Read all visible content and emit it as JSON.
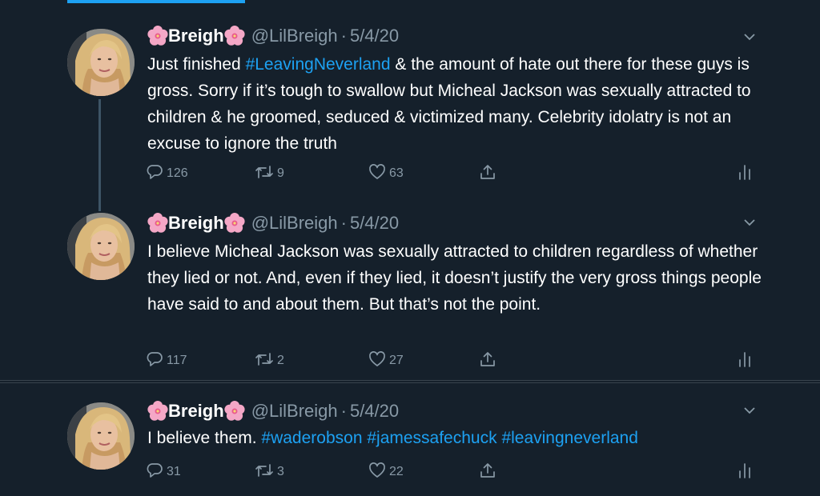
{
  "colors": {
    "background": "#15202b",
    "accent": "#1da1f2",
    "secondary_text": "#8899a6",
    "divider": "#38444d"
  },
  "tweets": [
    {
      "display_name": "Breigh",
      "handle": "@LilBreigh",
      "separator": "·",
      "date": "5/4/20",
      "text_parts": {
        "a": "Just finished ",
        "hashtag": "#LeavingNeverland",
        "b": " & the amount of hate out there for these guys is gross.  Sorry if it’s tough to swallow but Micheal Jackson was sexually attracted to children & he groomed, seduced & victimized many.  Celebrity idolatry is not an excuse to ignore the truth"
      },
      "replies": "126",
      "retweets": "9",
      "likes": "63"
    },
    {
      "display_name": "Breigh",
      "handle": "@LilBreigh",
      "separator": "·",
      "date": "5/4/20",
      "text": "I believe Micheal Jackson was sexually attracted to children regardless of whether they lied or not.  And, even if they lied, it doesn’t justify the very gross things people have said to and about them.  But that’s not the point.",
      "replies": "117",
      "retweets": "2",
      "likes": "27"
    },
    {
      "display_name": "Breigh",
      "handle": "@LilBreigh",
      "separator": "·",
      "date": "5/4/20",
      "text_parts": {
        "a": "I believe them.  ",
        "h1": "#waderobson",
        "h2": "#jamessafechuck",
        "h3": "#leavingneverland"
      },
      "replies": "31",
      "retweets": "3",
      "likes": "22"
    }
  ],
  "icons": {
    "flower": "cherry-blossom-emoji",
    "caret": "chevron-down-icon",
    "reply": "reply-icon",
    "retweet": "retweet-icon",
    "like": "heart-icon",
    "share": "share-icon",
    "analytics": "analytics-icon"
  }
}
